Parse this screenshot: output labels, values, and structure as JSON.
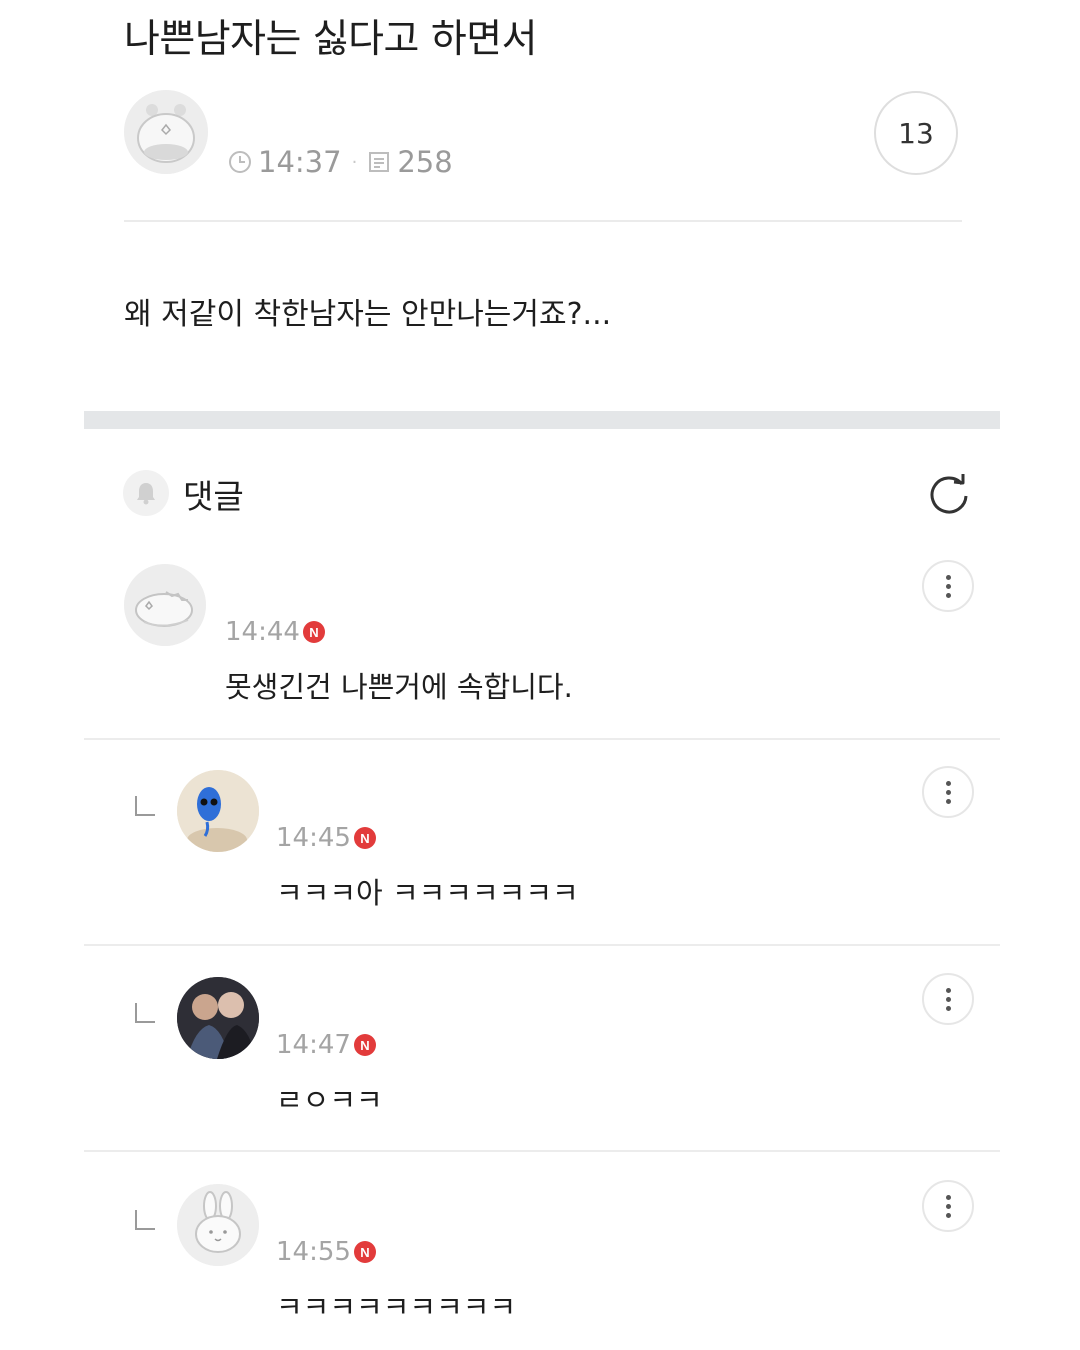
{
  "post": {
    "title": "나쁜남자는 싫다고 하면서",
    "time": "14:37",
    "views": "258",
    "comment_count": "13",
    "body": "왜 저같이 착한남자는 안만나는거죠?..."
  },
  "comments_section": {
    "label": "댓글"
  },
  "comments": [
    {
      "time": "14:44",
      "badge": "N",
      "text": "못생긴건 나쁜거에 속합니다."
    },
    {
      "time": "14:45",
      "badge": "N",
      "text": "ㅋㅋㅋ아 ㅋㅋㅋㅋㅋㅋㅋ"
    },
    {
      "time": "14:47",
      "badge": "N",
      "text": "ㄹㅇㅋㅋ"
    },
    {
      "time": "14:55",
      "badge": "N",
      "text": "ㅋㅋㅋㅋㅋㅋㅋㅋㅋ"
    }
  ],
  "colors": {
    "badge": "#e23b3b",
    "separator": "#ececec",
    "section_band": "#e4e6e8"
  },
  "icons": {
    "clock": "clock-icon",
    "views": "document-icon",
    "bell": "bell-icon",
    "refresh": "refresh-icon",
    "more": "more-vertical-icon",
    "reply": "reply-indent-icon"
  }
}
